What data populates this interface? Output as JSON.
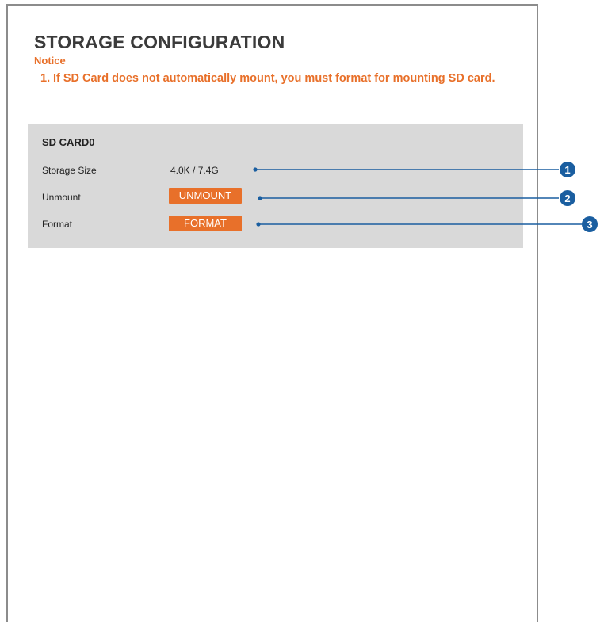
{
  "page": {
    "title": "STORAGE CONFIGURATION",
    "notice_label": "Notice",
    "notice_number": "1.",
    "notice_text": "If SD Card does not automatically mount, you must format for mounting SD card."
  },
  "sd_card": {
    "title": "SD CARD0",
    "storage_size_label": "Storage Size",
    "storage_size_value": "4.0K / 7.4G",
    "unmount_label": "Unmount",
    "unmount_button": "UNMOUNT",
    "format_label": "Format",
    "format_button": "FORMAT"
  },
  "callouts": [
    "1",
    "2",
    "3"
  ],
  "colors": {
    "accent": "#e8702a",
    "notice": "#e8702a",
    "callout": "#1a5ea0",
    "panel": "#d9d9d9"
  }
}
